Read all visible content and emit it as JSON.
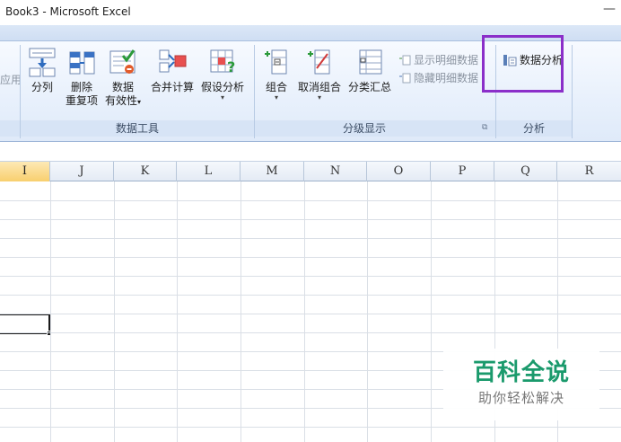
{
  "window": {
    "title": "Book3 - Microsoft Excel",
    "minimize_glyph": "—"
  },
  "ribbon": {
    "left_cut_label": "应用",
    "groups": {
      "data_tools": {
        "label": "数据工具",
        "buttons": [
          {
            "id": "split",
            "label": "分列",
            "label2": "",
            "icon": "text-to-columns-icon"
          },
          {
            "id": "remove_dup",
            "label": "删除",
            "label2": "重复项",
            "icon": "remove-duplicates-icon"
          },
          {
            "id": "validation",
            "label": "数据",
            "label2": "有效性",
            "caret": "▾",
            "icon": "data-validation-icon"
          },
          {
            "id": "consolidate",
            "label": "合并计算",
            "label2": "",
            "icon": "consolidate-icon"
          },
          {
            "id": "whatif",
            "label": "假设分析",
            "label2": "",
            "caret": "▾",
            "icon": "what-if-analysis-icon"
          }
        ]
      },
      "outline": {
        "label": "分级显示",
        "buttons": [
          {
            "id": "group",
            "label": "组合",
            "caret": "▾",
            "icon": "group-icon"
          },
          {
            "id": "ungroup",
            "label": "取消组合",
            "caret": "▾",
            "icon": "ungroup-icon"
          },
          {
            "id": "subtotal",
            "label": "分类汇总",
            "icon": "subtotal-icon"
          }
        ],
        "small": [
          {
            "id": "show_detail",
            "label": "显示明细数据",
            "icon": "show-detail-icon"
          },
          {
            "id": "hide_detail",
            "label": "隐藏明细数据",
            "icon": "hide-detail-icon"
          }
        ],
        "launcher_glyph": "⧉"
      },
      "analysis": {
        "label": "分析",
        "button": {
          "id": "data_analysis",
          "label": "数据分析",
          "icon": "data-analysis-icon"
        }
      }
    }
  },
  "sheet": {
    "columns": [
      "I",
      "J",
      "K",
      "L",
      "M",
      "N",
      "O",
      "P",
      "Q",
      "R"
    ],
    "active_column": "I"
  },
  "watermark": {
    "title": "百科全说",
    "subtitle": "助你轻松解决"
  },
  "colors": {
    "highlight_box": "#8b2fc9",
    "watermark_green": "#1a9a6c",
    "ribbon_bg": "#e9f1fc"
  }
}
